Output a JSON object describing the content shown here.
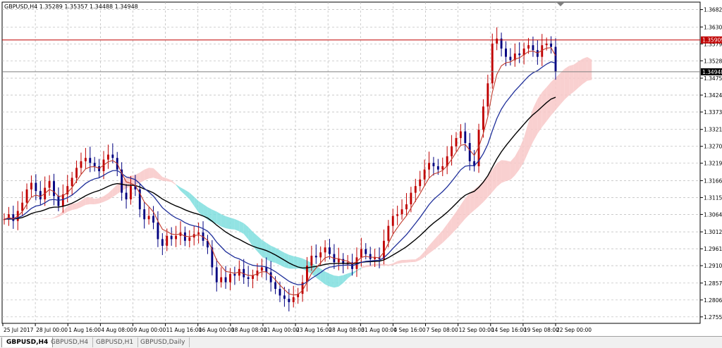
{
  "symbol_info": "GBPUSD,H4  1.35289 1.35357 1.34488 1.34948",
  "tabs": [
    {
      "label": "GBPUSD,H4",
      "active": true
    },
    {
      "label": "GBPUSD,H4",
      "active": false
    },
    {
      "label": "GBPUSD,H1",
      "active": false
    },
    {
      "label": "GBPUSD,Daily",
      "active": false
    }
  ],
  "chart_data": {
    "type": "candlestick",
    "symbol": "GBPUSD",
    "timeframe": "H4",
    "ylim": [
      1.2736,
      1.3705
    ],
    "y_ticks": [
      "1.36825",
      "1.36300",
      "1.35790",
      "1.35280",
      "1.34755",
      "1.34245",
      "1.33735",
      "1.33210",
      "1.32700",
      "1.32190",
      "1.31665",
      "1.31155",
      "1.30645",
      "1.30120",
      "1.29610",
      "1.29100",
      "1.28575",
      "1.28065",
      "1.27555"
    ],
    "x_ticks": [
      "25 Jul 2017",
      "28 Jul 00:00",
      "1 Aug 16:00",
      "4 Aug 08:00",
      "9 Aug 00:00",
      "11 Aug 16:00",
      "16 Aug 00:00",
      "18 Aug 08:00",
      "21 Aug 00:00",
      "23 Aug 16:00",
      "28 Aug 08:00",
      "31 Aug 00:00",
      "4 Sep 16:00",
      "7 Sep 08:00",
      "12 Sep 00:00",
      "14 Sep 16:00",
      "19 Sep 08:00",
      "22 Sep 00:00"
    ],
    "horizontal_lines": [
      {
        "price": 1.35909,
        "label": "1.35909",
        "color": "#c00000"
      },
      {
        "price": 1.34948,
        "label": "1.34948",
        "color": "#7f7f7f"
      }
    ],
    "close_series": [
      1.305,
      1.3065,
      1.3045,
      1.3075,
      1.31,
      1.314,
      1.316,
      1.3135,
      1.311,
      1.3145,
      1.3165,
      1.312,
      1.309,
      1.3125,
      1.315,
      1.3175,
      1.3205,
      1.3225,
      1.3235,
      1.322,
      1.321,
      1.3195,
      1.323,
      1.3245,
      1.3235,
      1.32,
      1.313,
      1.311,
      1.315,
      1.314,
      1.308,
      1.305,
      1.306,
      1.304,
      1.299,
      1.297,
      1.3,
      1.299,
      1.3,
      1.301,
      1.2985,
      1.2995,
      1.3005,
      1.301,
      1.2985,
      1.2965,
      1.2905,
      1.286,
      1.2875,
      1.286,
      1.2885,
      1.288,
      1.29,
      1.2875,
      1.287,
      1.288,
      1.2895,
      1.2905,
      1.289,
      1.286,
      1.284,
      1.282,
      1.281,
      1.28,
      1.2815,
      1.2825,
      1.286,
      1.291,
      1.294,
      1.2935,
      1.295,
      1.2965,
      1.2945,
      1.292,
      1.293,
      1.2915,
      1.292,
      1.29,
      1.2935,
      1.296,
      1.2945,
      1.293,
      1.2935,
      1.293,
      1.2985,
      1.303,
      1.306,
      1.3065,
      1.308,
      1.3095,
      1.313,
      1.315,
      1.317,
      1.32,
      1.322,
      1.321,
      1.32,
      1.321,
      1.324,
      1.327,
      1.3295,
      1.3315,
      1.328,
      1.3225,
      1.321,
      1.332,
      1.339,
      1.346,
      1.358,
      1.3595,
      1.3565,
      1.354,
      1.353,
      1.355,
      1.3545,
      1.3565,
      1.3575,
      1.356,
      1.354,
      1.3575,
      1.358,
      1.357,
      1.3495
    ],
    "indicators": [
      {
        "type": "moving_average",
        "color": "#c0392b",
        "style": "thin"
      },
      {
        "type": "moving_average",
        "color": "#1f2f9a"
      },
      {
        "type": "moving_average",
        "color": "#000000"
      },
      {
        "type": "ichimoku_cloud",
        "bull_color": "#7fdede",
        "bear_color": "#f8c8c8"
      }
    ],
    "grid": true,
    "background": "#ffffff",
    "bull_candle_color": "#c00000",
    "bear_candle_color": "#000080"
  }
}
